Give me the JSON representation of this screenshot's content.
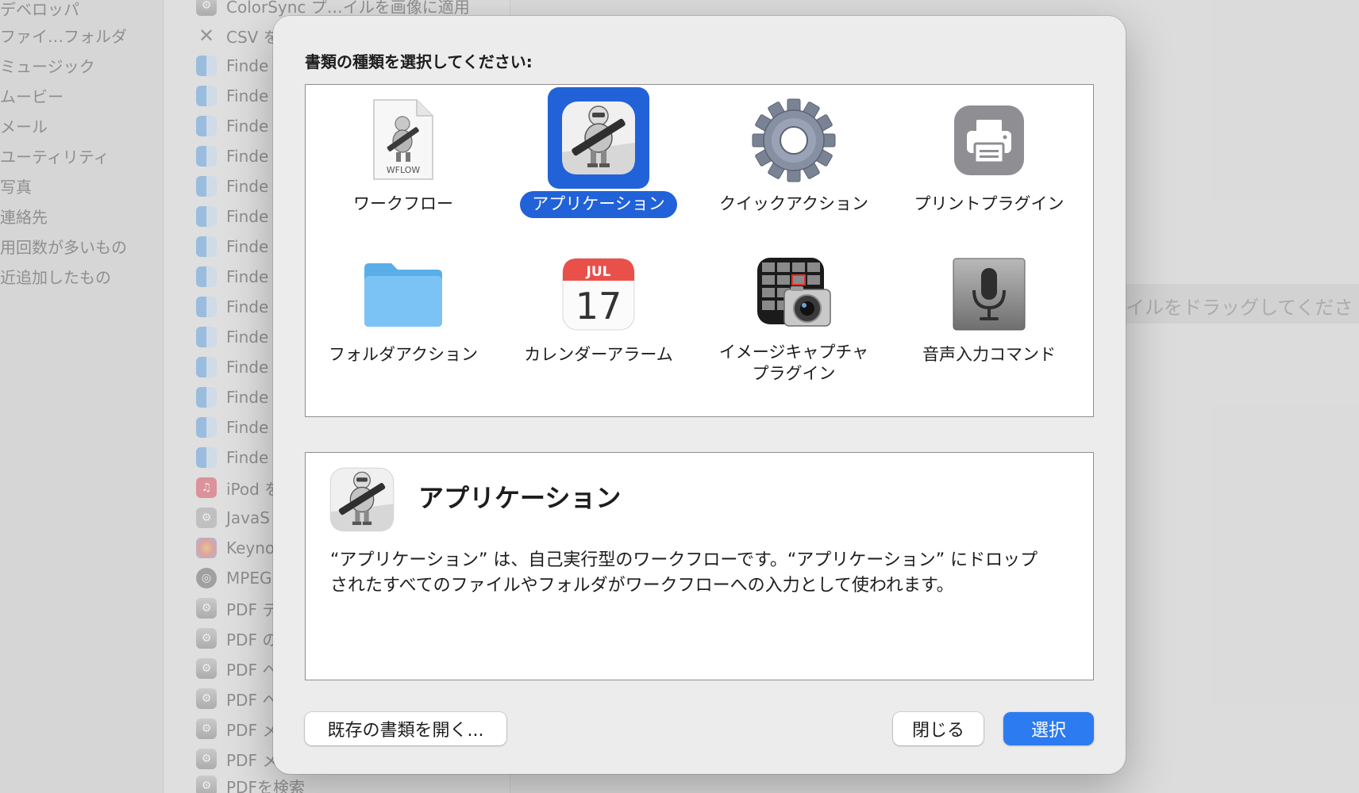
{
  "background": {
    "sidebar_items": [
      "デベロッパ",
      "ファイ…フォルダ",
      "ミュージック",
      "ムービー",
      "メール",
      "ユーティリティ",
      "写真",
      "連絡先",
      "用回数が多いもの",
      "近追加したもの"
    ],
    "list_rows": [
      {
        "label": "ColorSync プ…イルを画像に適用",
        "icon": "automator-icon"
      },
      {
        "label": "CSV を",
        "icon": "tools-icon"
      },
      {
        "label": "Finde",
        "icon": "finder-icon"
      },
      {
        "label": "Finde",
        "icon": "finder-icon"
      },
      {
        "label": "Finde",
        "icon": "finder-icon"
      },
      {
        "label": "Finde",
        "icon": "finder-icon"
      },
      {
        "label": "Finde",
        "icon": "finder-icon"
      },
      {
        "label": "Finde",
        "icon": "finder-icon"
      },
      {
        "label": "Finde",
        "icon": "finder-icon"
      },
      {
        "label": "Finde",
        "icon": "finder-icon"
      },
      {
        "label": "Finde",
        "icon": "finder-icon"
      },
      {
        "label": "Finde",
        "icon": "finder-icon"
      },
      {
        "label": "Finde",
        "icon": "finder-icon"
      },
      {
        "label": "Finde",
        "icon": "finder-icon"
      },
      {
        "label": "Finde",
        "icon": "finder-icon"
      },
      {
        "label": "Finde",
        "icon": "finder-icon"
      },
      {
        "label": "iPod を",
        "icon": "music-icon"
      },
      {
        "label": "JavaS",
        "icon": "java-icon"
      },
      {
        "label": "Keyno",
        "icon": "photos-icon"
      },
      {
        "label": "MPEG",
        "icon": "mpeg-icon"
      },
      {
        "label": "PDF デ",
        "icon": "automator-icon"
      },
      {
        "label": "PDF の",
        "icon": "automator-icon"
      },
      {
        "label": "PDF へ",
        "icon": "automator-icon"
      },
      {
        "label": "PDF へ",
        "icon": "automator-icon"
      },
      {
        "label": "PDF メ",
        "icon": "automator-icon"
      },
      {
        "label": "PDF メ",
        "icon": "automator-icon"
      },
      {
        "label": "PDFを検索",
        "icon": "automator-icon"
      }
    ],
    "drop_hint": "イルをドラッグしてくださ"
  },
  "dialog": {
    "prompt": "書類の種類を選択してください:",
    "types": [
      {
        "label": "ワークフロー",
        "icon": "workflow-document-icon",
        "badge": "WFLOW",
        "selected": false
      },
      {
        "label": "アプリケーション",
        "icon": "automator-robot-icon",
        "selected": true
      },
      {
        "label": "クイックアクション",
        "icon": "gear-icon",
        "selected": false
      },
      {
        "label": "プリントプラグイン",
        "icon": "printer-icon",
        "selected": false
      },
      {
        "label": "フォルダアクション",
        "icon": "folder-icon",
        "selected": false
      },
      {
        "label": "カレンダーアラーム",
        "icon": "calendar-icon",
        "month": "JUL",
        "day": "17",
        "selected": false
      },
      {
        "label": "イメージキャプチャ\nプラグイン",
        "label_line1": "イメージキャプチャ",
        "label_line2": "プラグイン",
        "icon": "image-capture-camera-icon",
        "selected": false
      },
      {
        "label": "音声入力コマンド",
        "icon": "microphone-icon",
        "selected": false
      }
    ],
    "description": {
      "title": "アプリケーション",
      "text": "“アプリケーション” は、自己実行型のワークフローです。“アプリケーション” にドロップされたすべてのファイルやフォルダがワークフローへの入力として使われます。"
    },
    "buttons": {
      "open_existing": "既存の書類を開く...",
      "close": "閉じる",
      "choose": "選択"
    }
  },
  "colors": {
    "accent": "#2162d9",
    "primary_button": "#2d7bf0",
    "dialog_bg": "#ececec",
    "panel_border": "#8e8e8e"
  }
}
